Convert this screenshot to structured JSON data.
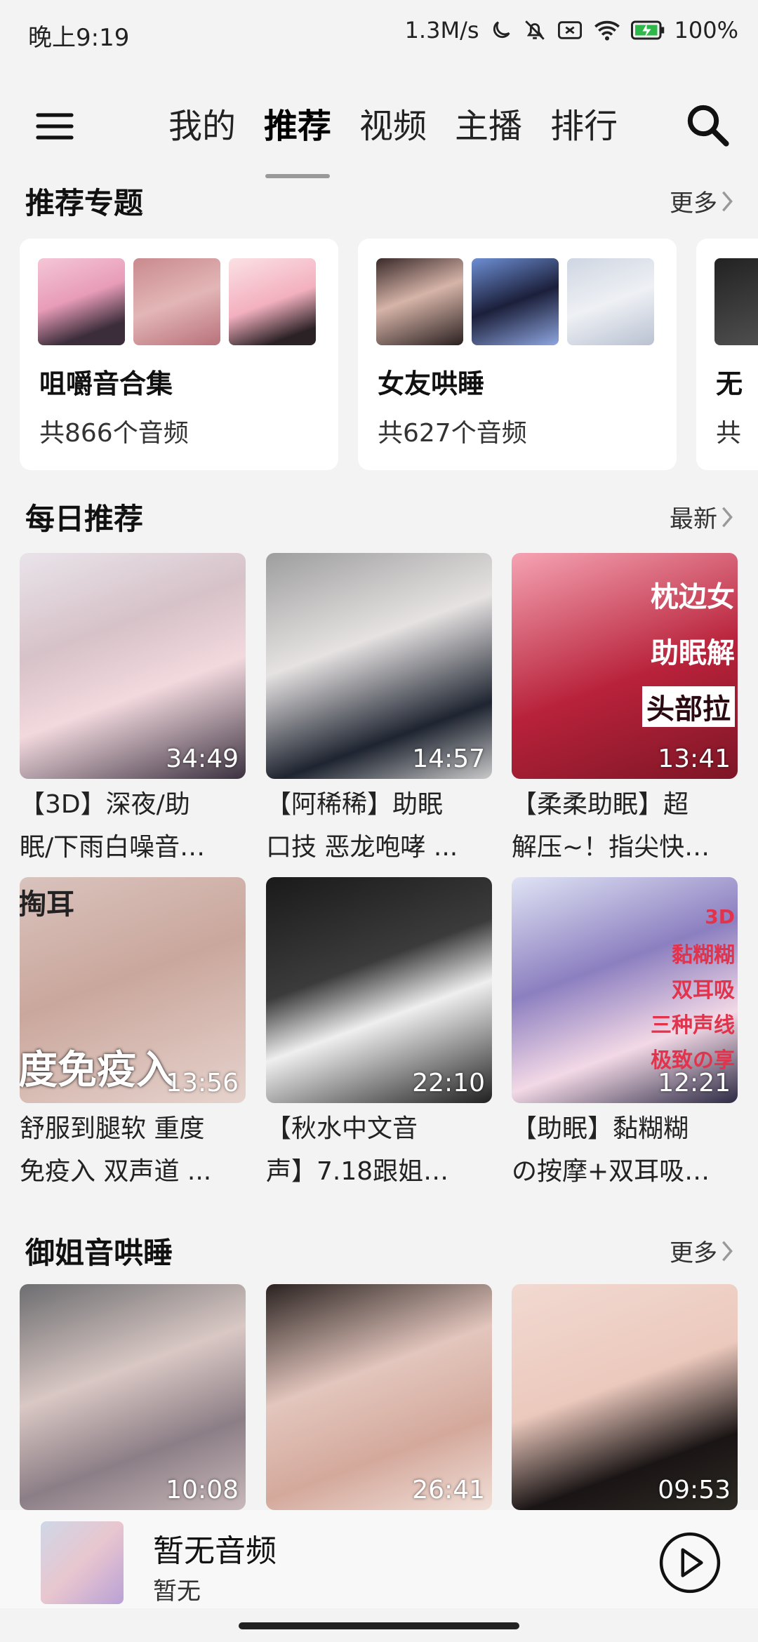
{
  "status_bar": {
    "time": "晚上9:19",
    "network_speed": "1.3M/s",
    "battery": "100%",
    "icons": [
      "moon-icon",
      "bell-off-icon",
      "sim-off-icon",
      "wifi-icon",
      "battery-charging-icon"
    ]
  },
  "nav": {
    "tabs": [
      {
        "label": "我的",
        "active": false
      },
      {
        "label": "推荐",
        "active": true
      },
      {
        "label": "视频",
        "active": false
      },
      {
        "label": "主播",
        "active": false
      },
      {
        "label": "排行",
        "active": false
      }
    ]
  },
  "featured": {
    "title": "推荐专题",
    "more": "更多",
    "cards": [
      {
        "name": "咀嚼音合集",
        "count": "共866个音频"
      },
      {
        "name": "女友哄睡",
        "count": "共627个音频"
      },
      {
        "name": "无",
        "count": "共"
      }
    ]
  },
  "daily": {
    "title": "每日推荐",
    "more": "最新",
    "items": [
      {
        "duration": "34:49",
        "line1": "【3D】深夜/助",
        "line2": "眠/下雨白噪音…"
      },
      {
        "duration": "14:57",
        "line1": "【阿稀稀】助眠",
        "line2": "口技 恶龙咆哮 ..."
      },
      {
        "duration": "13:41",
        "line1": "【柔柔助眠】超",
        "line2": "解压~！指尖快…",
        "overlay": [
          "枕边女",
          "助眠解",
          "头部拉"
        ]
      },
      {
        "duration": "13:56",
        "line1": "舒服到腿软 重度",
        "line2": "免疫入 双声道 ...",
        "overlay": [
          "掏耳",
          "度免疫入"
        ]
      },
      {
        "duration": "22:10",
        "line1": "【秋水中文音",
        "line2": "声】7.18跟姐…"
      },
      {
        "duration": "12:21",
        "line1": "【助眠】黏糊糊",
        "line2": "の按摩+双耳吸…",
        "overlay": [
          "3D",
          "黏糊糊",
          "双耳吸",
          "三种声线",
          "极致の享"
        ]
      }
    ]
  },
  "yujie": {
    "title": "御姐音哄睡",
    "more": "更多",
    "items": [
      {
        "duration": "10:08"
      },
      {
        "duration": "26:41"
      },
      {
        "duration": "09:53"
      }
    ]
  },
  "player": {
    "title": "暂无音频",
    "subtitle": "暂无"
  }
}
